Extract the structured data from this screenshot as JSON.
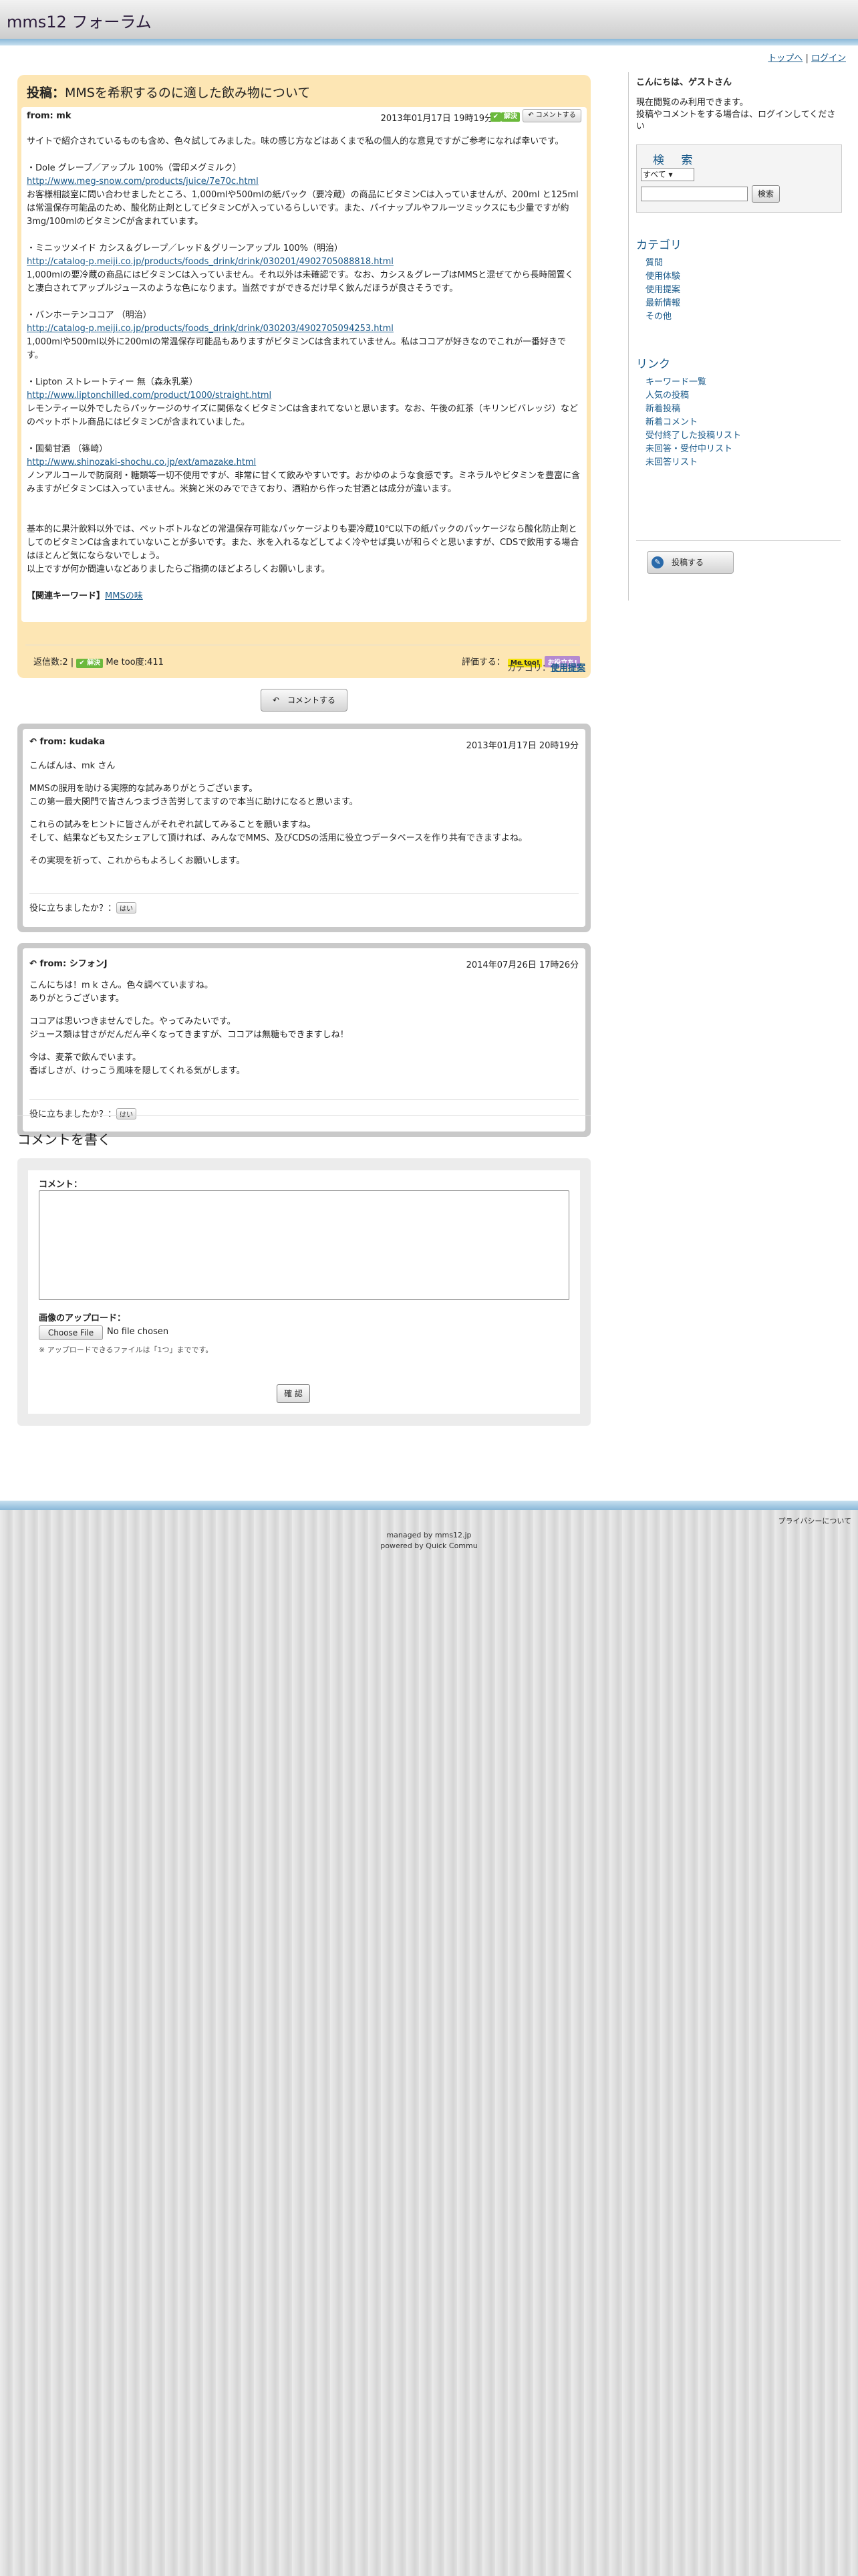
{
  "site": {
    "title": "mms12 フォーラム"
  },
  "toplinks": {
    "top": "トップへ",
    "sep": "|",
    "login": "ログイン"
  },
  "post": {
    "title_prefix": "投稿：",
    "title": "MMSを希釈するのに適した飲み物について",
    "from": "from: mk",
    "date": "2013年01月17日 19時19分",
    "solved_badge": "解決",
    "comment_mini": "コメントする",
    "intro": "サイトで紹介されているものも含め、色々試してみました。味の感じ方などはあくまで私の個人的な意見ですがご参考になれば幸いです。",
    "items": [
      {
        "name": "・Dole グレープ／アップル 100%（雪印メグミルク）",
        "url": "http://www.meg-snow.com/products/juice/7e70c.html",
        "desc": "お客様相談室に問い合わせましたところ、1,000mlや500mlの紙パック（要冷蔵）の商品にビタミンCは入っていませんが、200ml と125ml は常温保存可能品のため、酸化防止剤としてビタミンCが入っているらしいです。また、パイナップルやフルーツミックスにも少量ですが約3mg/100mlのビタミンCが含まれています。"
      },
      {
        "name": "・ミニッツメイド カシス＆グレープ／レッド＆グリーンアップル 100%（明治）",
        "url": "http://catalog-p.meiji.co.jp/products/foods_drink/drink/030201/4902705088818.html",
        "desc": "1,000mlの要冷蔵の商品にはビタミンCは入っていません。それ以外は未確認です。なお、カシス＆グレープはMMSと混ぜてから長時間置くと凄白されてアップルジュースのような色になります。当然ですができるだけ早く飲んだほうが良さそうです。"
      },
      {
        "name": "・バンホーテンココア （明治）",
        "url": "http://catalog-p.meiji.co.jp/products/foods_drink/drink/030203/4902705094253.html",
        "desc": "1,000mlや500ml以外に200mlの常温保存可能品もありますがビタミンCは含まれていません。私はココアが好きなのでこれが一番好きです。"
      },
      {
        "name": "・Lipton ストレートティー 無（森永乳業）",
        "url": "http://www.liptonchilled.com/product/1000/straight.html",
        "desc": "レモンティー以外でしたらパッケージのサイズに関係なくビタミンCは含まれてないと思います。なお、午後の紅茶（キリンビバレッジ）などのペットボトル商品にはビタミンCが含まれていました。"
      },
      {
        "name": "・国菊甘酒 （篠崎）",
        "url": "http://www.shinozaki-shochu.co.jp/ext/amazake.html",
        "desc": "ノンアルコールで防腐剤・糖類等一切不使用ですが、非常に甘くて飲みやすいです。おかゆのような食感です。ミネラルやビタミンを豊富に含みますがビタミンCは入っていません。米麹と米のみでできており、酒粕から作った甘酒とは成分が違います。"
      }
    ],
    "outro": "基本的に果汁飲料以外では、ペットボトルなどの常温保存可能なパッケージよりも要冷蔵10℃以下の紙パックのパッケージなら酸化防止剤としてのビタミンCは含まれていないことが多いです。また、氷を入れるなどしてよく冷やせば臭いが和らぐと思いますが、CDSで飲用する場合はほとんど気にならないでしょう。\n以上ですが何か間違いなどありましたらご指摘のほどよろしくお願いします。",
    "keywords_label": "【関連キーワード】",
    "keyword": "MMSの味",
    "reply_count_label": "返信数:2",
    "metoo_count": "Me too度:411",
    "rate_label": "評価する：",
    "metoo_btn": "Me too!",
    "okawari_btn": "お役立ち!",
    "category_label": "カテゴリ：",
    "category": "使用提案"
  },
  "comment_button": "コメントする",
  "replies": [
    {
      "from": "from: kudaka",
      "date": "2013年01月17日 20時19分",
      "paragraphs": [
        "こんばんは、mk さん",
        "MMSの服用を助ける実際的な試みありがとうございます。\nこの第一最大関門で皆さんつまづき苦労してますので本当に助けになると思います。",
        "これらの試みをヒントに皆さんがそれぞれ試してみることを願いますね。\nそして、結果なども又たシェアして頂ければ、みんなでMMS、及びCDSの活用に役立つデータベースを作り共有できますよね。",
        "その実現を祈って、これからもよろしくお願いします。"
      ],
      "useful_label": "役に立ちましたか？：",
      "yes": "はい"
    },
    {
      "from": "from: シフォンJ",
      "date": "2014年07月26日 17時26分",
      "paragraphs": [
        "こんにちは！m k さん。色々調べていますね。\nありがとうございます。",
        "ココアは思いつきませんでした。やってみたいです。\nジュース類は甘さがだんだん辛くなってきますが、ココアは無糖もできますしね！",
        "今は、麦茶で飲んでいます。\n香ばしさが、けっこう風味を隠してくれる気がします。"
      ],
      "useful_label": "役に立ちましたか？：",
      "yes": "はい"
    }
  ],
  "write": {
    "heading": "コメントを書く",
    "comment_label": "コメント：",
    "image_label": "画像のアップロード：",
    "file_button": "Choose File",
    "file_status": "No file chosen",
    "note": "※ アップロードできるファイルは「1つ」までです。",
    "confirm": "確 認"
  },
  "sidebar": {
    "greeting": "こんにちは、ゲストさん",
    "notice": "現在閲覧のみ利用できます。\n投稿やコメントをする場合は、ログインしてください",
    "search_heading": "検 索",
    "search_select": "すべて",
    "search_button": "検索",
    "category_heading": "カテゴリ",
    "categories": [
      "質問",
      "使用体験",
      "使用提案",
      "最新情報",
      "その他"
    ],
    "links_heading": "リンク",
    "links": [
      "キーワード一覧",
      "人気の投稿",
      "新着投稿",
      "新着コメント",
      "受付終了した投稿リスト",
      "未回答・受付中リスト",
      "未回答リスト"
    ],
    "post_button": "投稿する"
  },
  "footer": {
    "privacy": "プライバシーについて",
    "managed": "managed by mms12.jp",
    "powered": "powered by Quick Commu"
  },
  "colors": {
    "post_bg": "#fde6b4",
    "link": "#1a5a8a",
    "header_stripe": "#8ab8d8"
  }
}
